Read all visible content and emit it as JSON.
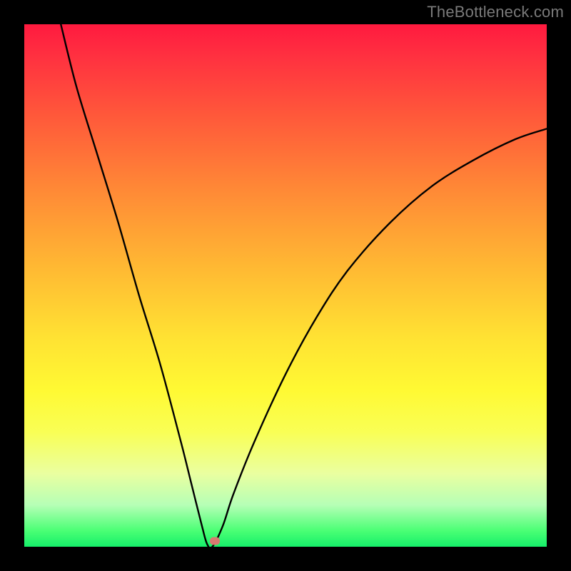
{
  "watermark": "TheBottleneck.com",
  "chart_data": {
    "type": "line",
    "title": "",
    "xlabel": "",
    "ylabel": "",
    "xlim": [
      0,
      100
    ],
    "ylim": [
      0,
      100
    ],
    "grid": false,
    "series": [
      {
        "name": "curve",
        "x": [
          7,
          10,
          14,
          18,
          22,
          26,
          30,
          32,
          34,
          35,
          36,
          38,
          40,
          44,
          50,
          56,
          62,
          70,
          78,
          86,
          94,
          100
        ],
        "y": [
          100,
          88,
          75,
          62,
          48,
          35,
          20,
          12,
          4,
          0.5,
          0,
          4,
          10,
          20,
          33,
          44,
          53,
          62,
          69,
          74,
          78,
          80
        ]
      }
    ],
    "marker": {
      "x": 36.5,
      "y": 1.1
    },
    "background_gradient": {
      "top": "#ff1a3f",
      "mid": "#ffe233",
      "bottom": "#16ef6a"
    }
  }
}
